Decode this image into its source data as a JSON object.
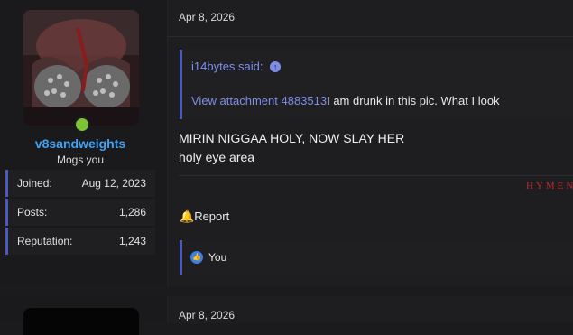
{
  "post1": {
    "username": "v8sandweights",
    "user_title": "Mogs you",
    "stats": [
      {
        "label": "Joined:",
        "value": "Aug 12, 2023"
      },
      {
        "label": "Posts:",
        "value": "1,286"
      },
      {
        "label": "Reputation:",
        "value": "1,243"
      }
    ],
    "date": "Apr 8, 2026",
    "quote": {
      "author_said": "i14bytes said:",
      "attachment_link": "View attachment 4883513",
      "text": "I am drunk in this pic. What I look"
    },
    "message_lines": [
      "MIRIN NIGGAA HOLY, NOW SLAY HER",
      "holy eye area"
    ],
    "signature": "HYMEN",
    "report_label": "Report",
    "reactions_text": "You"
  },
  "post2": {
    "date": "Apr 8, 2026"
  },
  "colors": {
    "background": "#1b1b1d",
    "accent_blue": "#3fa3f6",
    "quote_border": "#4b5bbd",
    "link": "#7c8ee6",
    "online": "#7cc436",
    "signature": "#c0262b"
  },
  "icons": {
    "quote_jump": "arrow-up-circle-icon",
    "report": "bell-icon",
    "reaction": "thumbs-up-icon"
  }
}
